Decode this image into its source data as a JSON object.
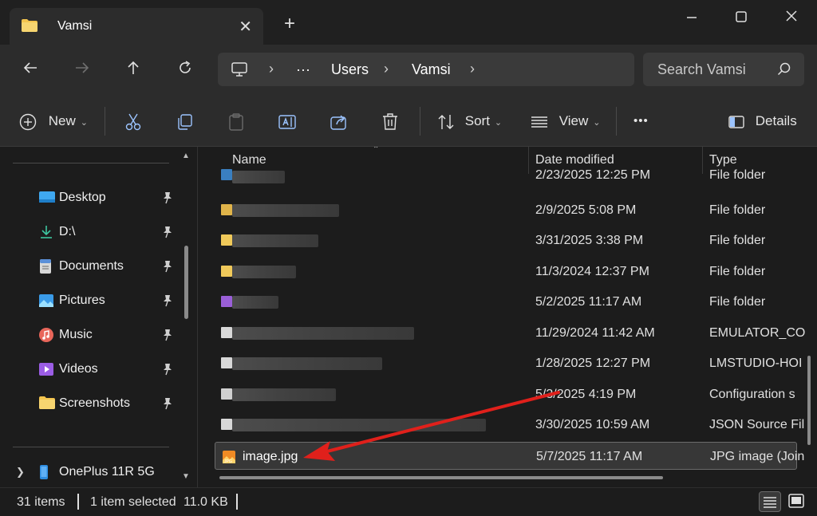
{
  "tab": {
    "title": "Vamsi"
  },
  "address": {
    "overflow": "···",
    "crumbs": [
      "Users",
      "Vamsi"
    ]
  },
  "search": {
    "placeholder": "Search Vamsi"
  },
  "commands": {
    "new": "New",
    "sort": "Sort",
    "view": "View",
    "more": "•••",
    "details": "Details"
  },
  "sidebar": {
    "items": [
      {
        "label": "Desktop",
        "icon": "desktop-icon"
      },
      {
        "label": "D:\\",
        "icon": "download-icon"
      },
      {
        "label": "Documents",
        "icon": "documents-icon"
      },
      {
        "label": "Pictures",
        "icon": "pictures-icon"
      },
      {
        "label": "Music",
        "icon": "music-icon"
      },
      {
        "label": "Videos",
        "icon": "videos-icon"
      },
      {
        "label": "Screenshots",
        "icon": "folder-icon"
      }
    ],
    "device": {
      "label": "OnePlus 11R 5G",
      "icon": "phone-icon"
    }
  },
  "columns": {
    "name": "Name",
    "date": "Date modified",
    "type": "Type"
  },
  "files": [
    {
      "date": "2/23/2025 12:25 PM",
      "type": "File folder"
    },
    {
      "date": "2/9/2025 5:08 PM",
      "type": "File folder"
    },
    {
      "date": "3/31/2025 3:38 PM",
      "type": "File folder"
    },
    {
      "date": "11/3/2024 12:37 PM",
      "type": "File folder"
    },
    {
      "date": "5/2/2025 11:17 AM",
      "type": "File folder"
    },
    {
      "date": "11/29/2024 11:42 AM",
      "type": "EMULATOR_CO"
    },
    {
      "date": "1/28/2025 12:27 PM",
      "type": "LMSTUDIO-HOI"
    },
    {
      "date": "5/3/2025 4:19 PM",
      "type": "Configuration s"
    },
    {
      "date": "3/30/2025 10:59 AM",
      "type": "JSON Source Fil"
    },
    {
      "name": "image.jpg",
      "date": "5/7/2025 11:17 AM",
      "type": "JPG image (Join"
    }
  ],
  "status": {
    "count": "31 items",
    "selected": "1 item selected",
    "size": "11.0 KB"
  },
  "colors": {
    "folder": "#f3c44e",
    "accent_red": "#e0201b",
    "background": "#1c1c1c",
    "toolbar": "#2c2c2c"
  }
}
